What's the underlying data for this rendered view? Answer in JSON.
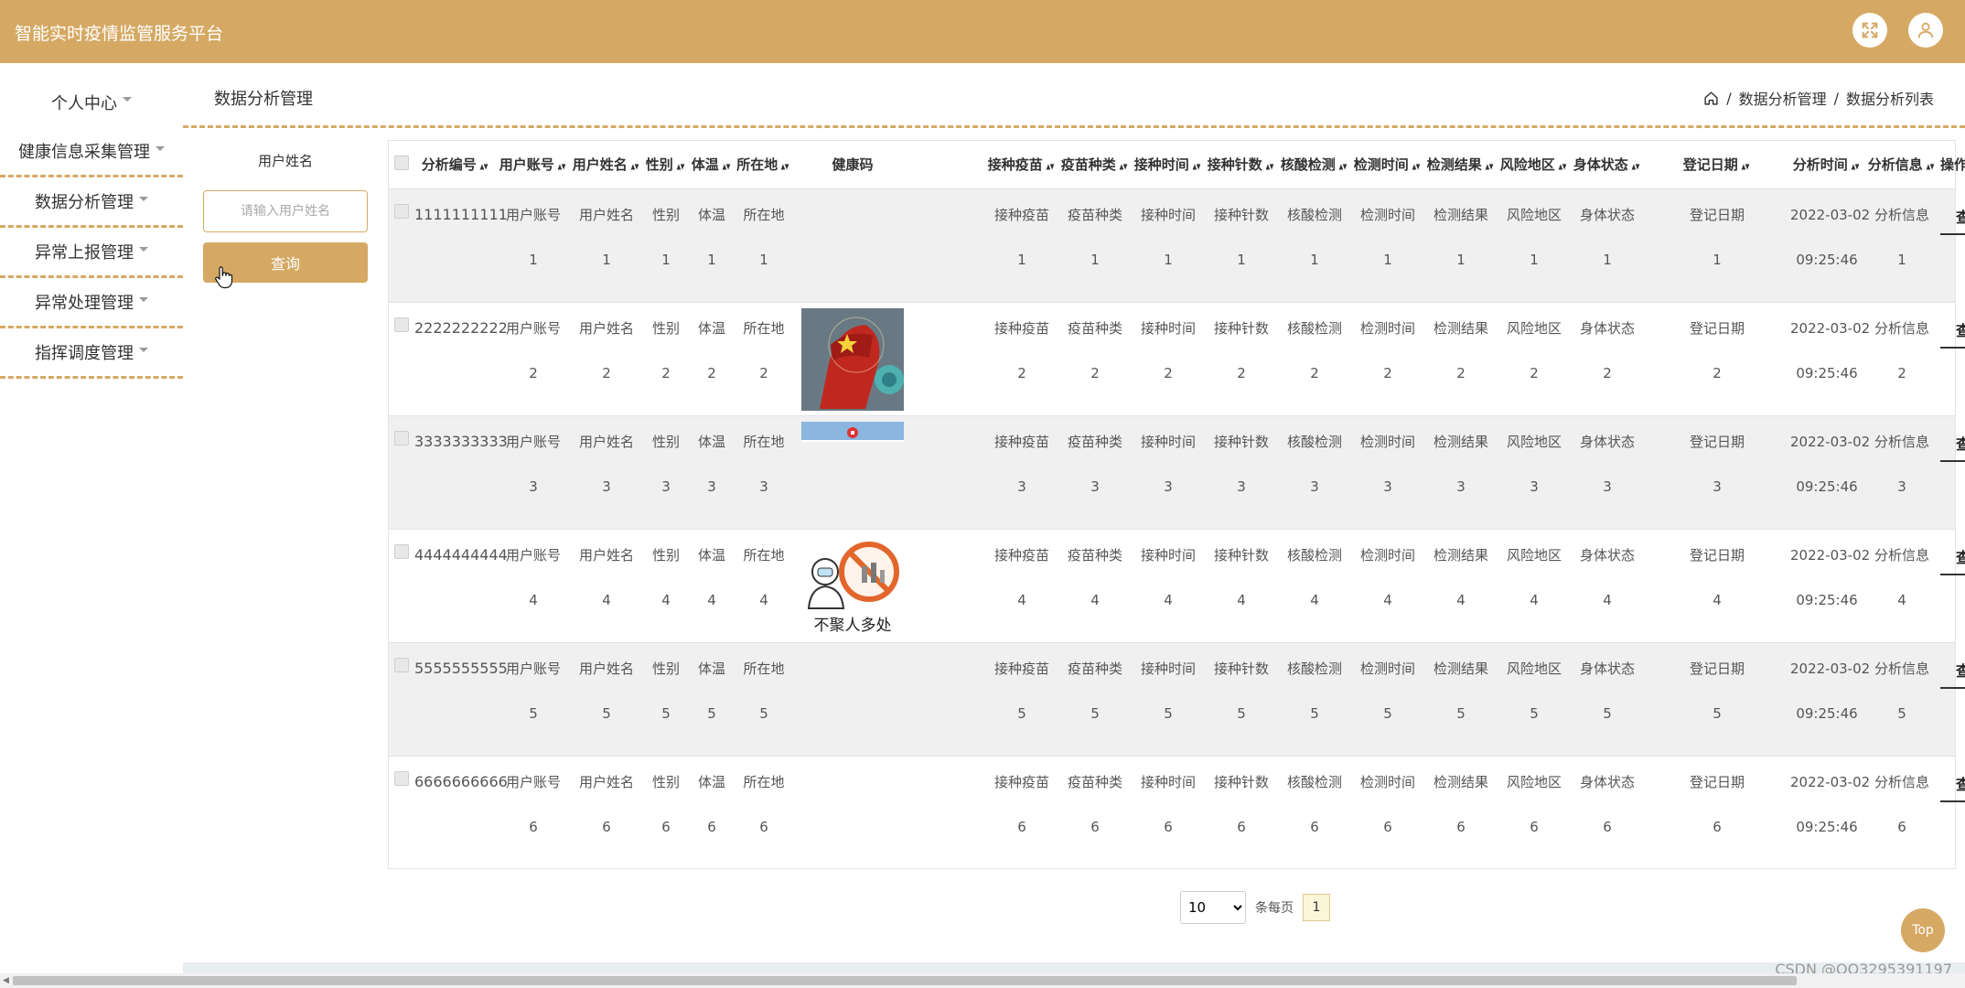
{
  "app": {
    "title": "智能实时疫情监管服务平台"
  },
  "header": {
    "fullscreen_icon": "fullscreen-icon",
    "user_icon": "user-icon"
  },
  "sidebar": {
    "items": [
      {
        "label": "个人中心"
      },
      {
        "label": "健康信息采集管理"
      },
      {
        "label": "数据分析管理"
      },
      {
        "label": "异常上报管理"
      },
      {
        "label": "异常处理管理"
      },
      {
        "label": "指挥调度管理"
      }
    ]
  },
  "page": {
    "title": "数据分析管理"
  },
  "breadcrumb": {
    "home_icon": "home-icon",
    "items": [
      "数据分析管理",
      "数据分析列表"
    ],
    "separator": "/"
  },
  "search": {
    "label": "用户姓名",
    "placeholder": "请输入用户姓名",
    "button_label": "查询"
  },
  "table": {
    "columns": [
      "分析编号",
      "用户账号",
      "用户姓名",
      "性别",
      "体温",
      "所在地",
      "健康码",
      "接种疫苗",
      "疫苗种类",
      "接种时间",
      "接种针数",
      "核酸检测",
      "检测时间",
      "检测结果",
      "风险地区",
      "身体状态",
      "登记日期",
      "分析时间",
      "分析信息",
      "操作"
    ],
    "sortable": [
      true,
      true,
      true,
      true,
      true,
      true,
      false,
      true,
      true,
      true,
      true,
      true,
      true,
      true,
      true,
      true,
      true,
      true,
      true,
      false
    ],
    "rows": [
      {
        "id": "1111111111",
        "date": "2022-03-02",
        "time": "09:25:46",
        "n": "1",
        "image": ""
      },
      {
        "id": "2222222222",
        "date": "2022-03-02",
        "time": "09:25:46",
        "n": "2",
        "image": "fist-virus"
      },
      {
        "id": "3333333333",
        "date": "2022-03-02",
        "time": "09:25:46",
        "n": "3",
        "image": "banner-strip"
      },
      {
        "id": "4444444444",
        "date": "2022-03-02",
        "time": "09:25:46",
        "n": "4",
        "image": "no-gathering"
      },
      {
        "id": "5555555555",
        "date": "2022-03-02",
        "time": "09:25:46",
        "n": "5",
        "image": ""
      },
      {
        "id": "6666666666",
        "date": "2022-03-02",
        "time": "09:25:46",
        "n": "6",
        "image": ""
      }
    ],
    "labels": [
      "用户账号",
      "用户姓名",
      "性别",
      "体温",
      "所在地",
      "接种疫苗",
      "疫苗种类",
      "接种时间",
      "接种针数",
      "核酸检测",
      "检测时间",
      "检测结果",
      "风险地区",
      "身体状态",
      "登记日期",
      "分析信息"
    ],
    "view_label": "查看",
    "image_texts": {
      "no_gathering": "不聚人多处"
    }
  },
  "pagination": {
    "page_size": "10",
    "per_page_label": "条每页",
    "current_page": "1"
  },
  "top_button": {
    "label": "Top"
  },
  "watermark": "CSDN @QQ3295391197",
  "colors": {
    "primary": "#d5a964",
    "row_alt": "#f0f0f0"
  }
}
